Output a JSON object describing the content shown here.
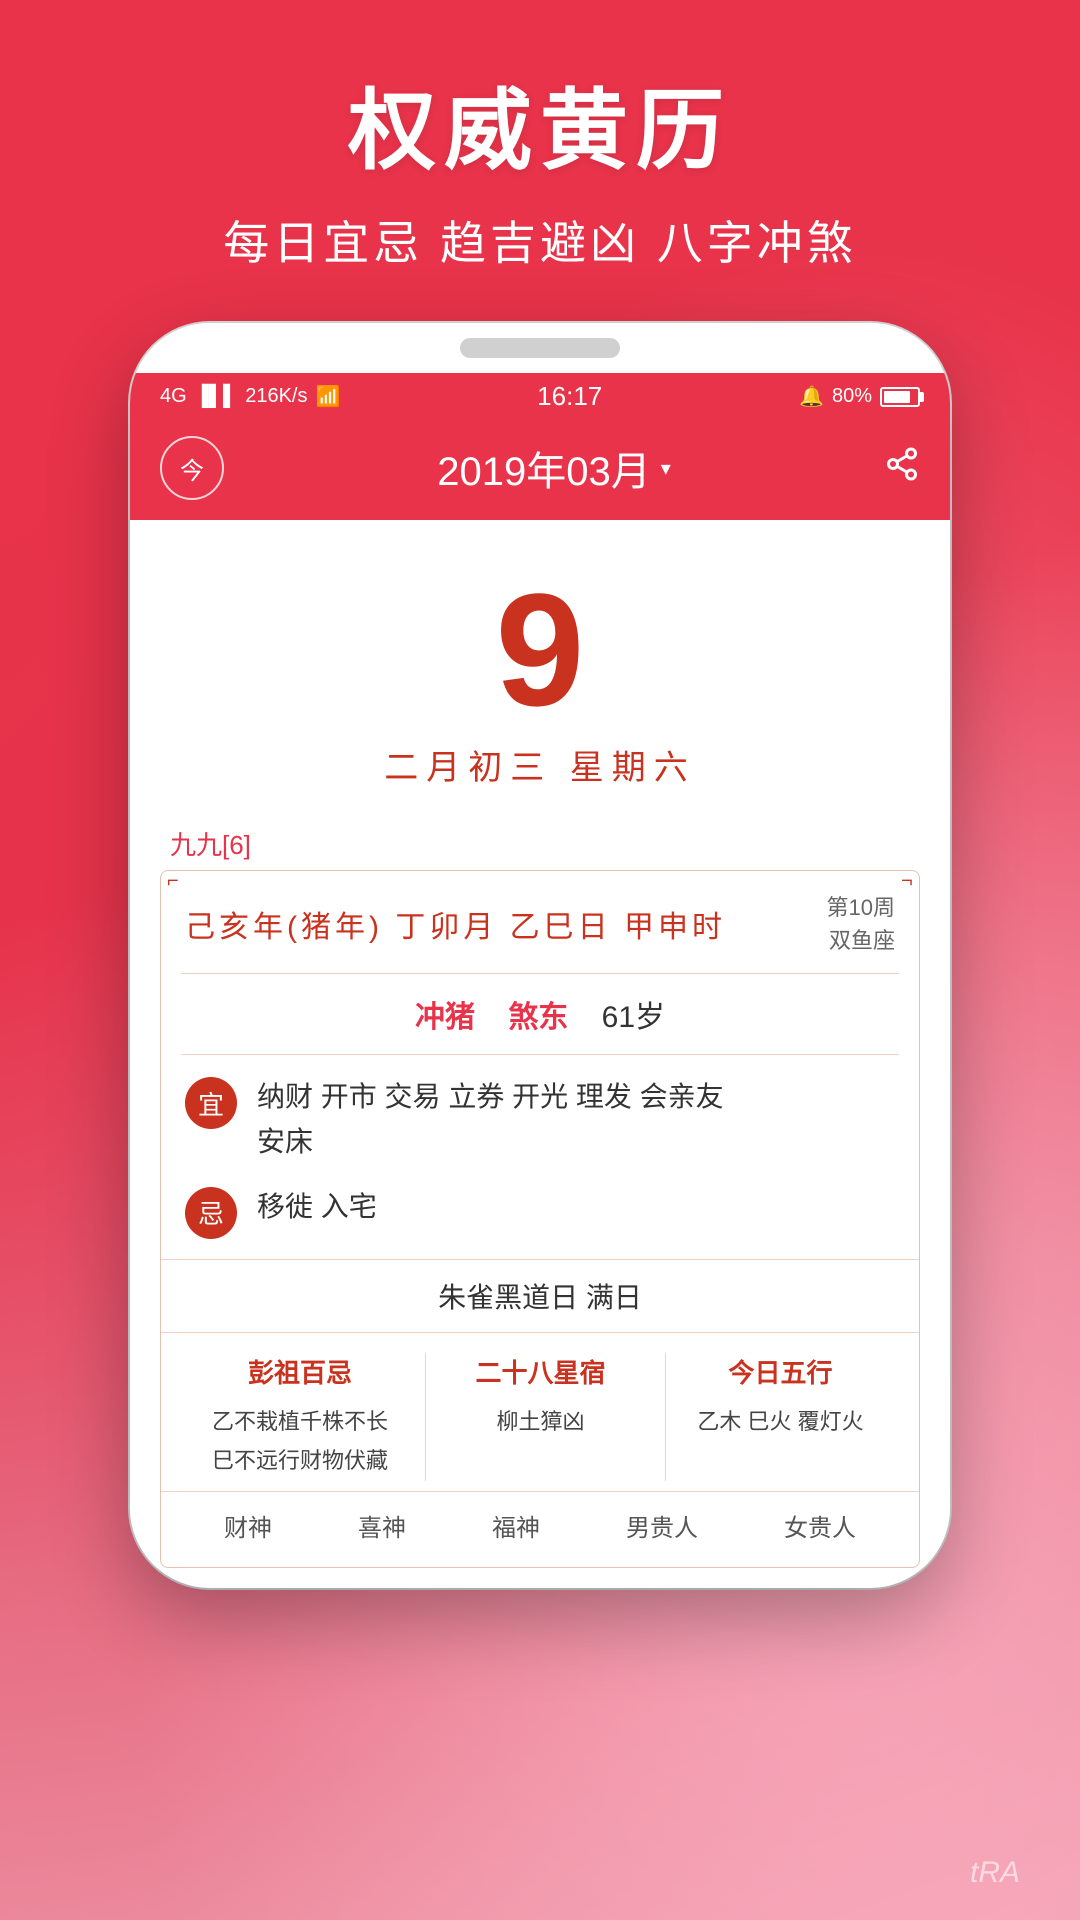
{
  "app": {
    "title": "权威黄历",
    "subtitle": "每日宜忌 趋吉避凶 八字冲煞"
  },
  "status_bar": {
    "network": "4G",
    "speed": "216K/s",
    "wifi": "WiFi",
    "time": "16:17",
    "alarm": "🔔",
    "battery_pct": "80%"
  },
  "navbar": {
    "today_label": "今",
    "month_title": "2019年03月",
    "dropdown_arrow": "▾"
  },
  "calendar": {
    "day": "9",
    "lunar": "二月初三  星期六"
  },
  "nine_nine": "九九[6]",
  "ganzhi": {
    "main": "己亥年(猪年)  丁卯月  乙巳日  甲申时",
    "sub_line1": "第10周",
    "sub_line2": "双鱼座"
  },
  "chong": {
    "label1": "冲猪",
    "label2": "煞东",
    "age": "61岁"
  },
  "yi": {
    "badge": "宜",
    "text": "纳财 开市 交易 立券 开光 理发 会亲友\n安床"
  },
  "ji": {
    "badge": "忌",
    "text": "移徙 入宅"
  },
  "blackday": "朱雀黑道日   满日",
  "columns": {
    "col1": {
      "header": "彭祖百忌",
      "lines": [
        "乙不栽植千株不长",
        "巳不远行财物伏藏"
      ]
    },
    "col2": {
      "header": "二十八星宿",
      "lines": [
        "柳土獐凶"
      ]
    },
    "col3": {
      "header": "今日五行",
      "lines": [
        "乙木 巳火 覆灯火"
      ]
    }
  },
  "bottom_labels": [
    "财神",
    "喜神",
    "福神",
    "男贵人",
    "女贵人"
  ],
  "watermark": "tRA"
}
